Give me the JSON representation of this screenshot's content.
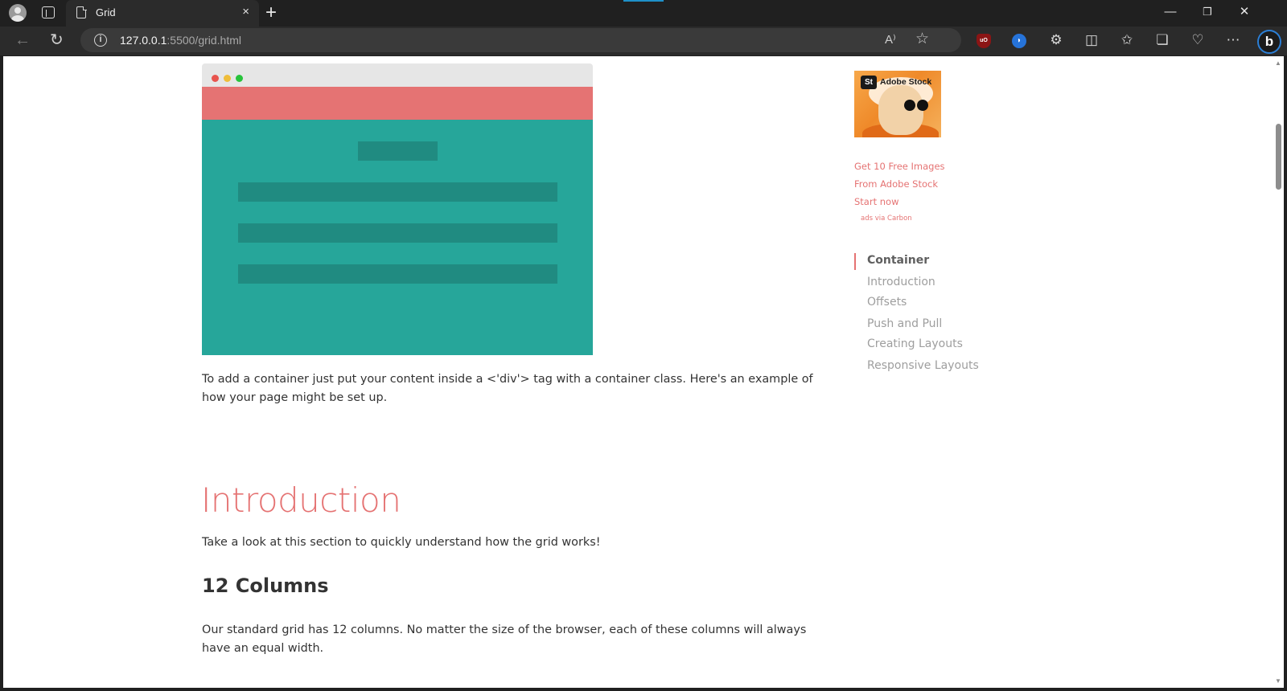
{
  "browser": {
    "tab_title": "Grid",
    "tab_close": "×",
    "new_tab": "+",
    "url_host": "127.0.0.1",
    "url_path": ":5500/grid.html",
    "window_controls": {
      "minimize": "—",
      "restore": "❐",
      "close": "✕"
    },
    "ext_ublock": "uO",
    "ext_blue": "◗",
    "bing": "b",
    "read_aloud": "A⁾",
    "favorite": "☆"
  },
  "page": {
    "container_paragraph": "To add a container just put your content inside a <'div'> tag with a container class. Here's an example of how your page might be set up.",
    "intro_heading": "Introduction",
    "intro_paragraph": "Take a look at this section to quickly understand how the grid works!",
    "columns_heading": "12 Columns",
    "columns_paragraph": "Our standard grid has 12 columns. No matter the size of the browser, each of these columns will always have an equal width."
  },
  "ad": {
    "badge": "St",
    "brand": "Adobe Stock",
    "line1": "Get 10 Free Images",
    "line2": "From Adobe Stock",
    "line3": "Start now",
    "via": "ads via Carbon"
  },
  "toc": {
    "items": [
      {
        "label": "Container",
        "active": true
      },
      {
        "label": "Introduction"
      },
      {
        "label": "Offsets"
      },
      {
        "label": "Push and Pull"
      },
      {
        "label": "Creating Layouts"
      },
      {
        "label": "Responsive Layouts"
      }
    ]
  },
  "colors": {
    "accent": "#e57373",
    "teal": "#26a69a",
    "teal_dark": "#208b81"
  }
}
